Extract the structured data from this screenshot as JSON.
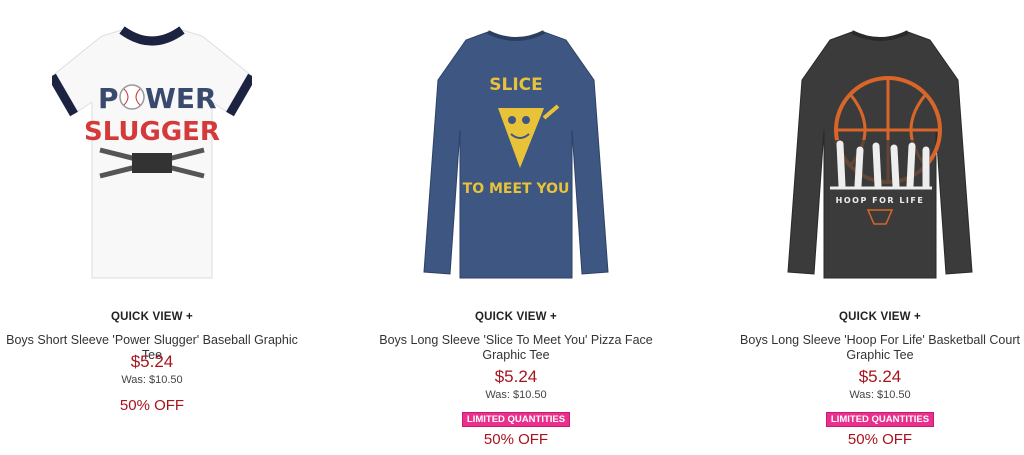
{
  "products": [
    {
      "quick_view": "QUICK VIEW +",
      "name": "Boys Short Sleeve 'Power Slugger' Baseball Graphic Tee",
      "price": "$5.24",
      "was": "Was: $10.50",
      "badge": "",
      "discount": "50% OFF",
      "shirt_color": "#ffffff",
      "graphic_text": [
        "P",
        "WER",
        "SLUGGER"
      ]
    },
    {
      "quick_view": "QUICK VIEW +",
      "name": "Boys Long Sleeve 'Slice To Meet You' Pizza Face Graphic Tee",
      "price": "$5.24",
      "was": "Was: $10.50",
      "badge": "LIMITED QUANTITIES",
      "discount": "50% OFF",
      "shirt_color": "#3d5580",
      "graphic_text": [
        "SLICE",
        "TO MEET YOU"
      ]
    },
    {
      "quick_view": "QUICK VIEW +",
      "name": "Boys Long Sleeve 'Hoop For Life' Basketball Court Graphic Tee",
      "price": "$5.24",
      "was": "Was: $10.50",
      "badge": "LIMITED QUANTITIES",
      "discount": "50% OFF",
      "shirt_color": "#3a3a3a",
      "graphic_text": [
        "HOOP FOR LIFE"
      ]
    }
  ],
  "colors": {
    "price": "#a8131d",
    "badge_bg": "#ea2f8d"
  }
}
